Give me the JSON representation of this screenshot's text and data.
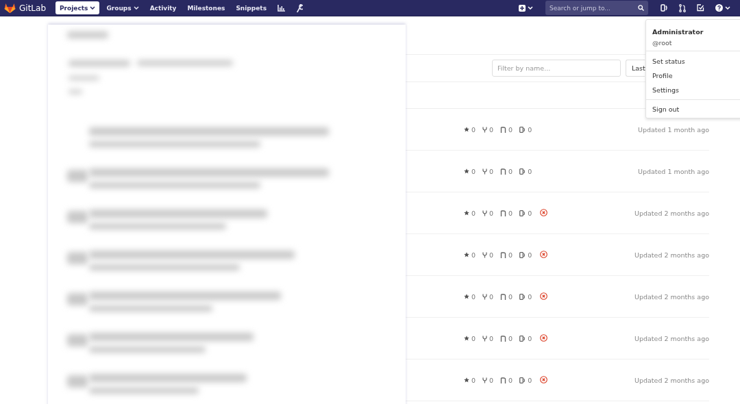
{
  "navbar": {
    "brand": "GitLab",
    "items": [
      {
        "kind": "text",
        "label": "Projects",
        "selected": true,
        "dropdown": true
      },
      {
        "kind": "text",
        "label": "Groups",
        "selected": false,
        "dropdown": true
      },
      {
        "kind": "text",
        "label": "Activity",
        "selected": false,
        "dropdown": false
      },
      {
        "kind": "text",
        "label": "Milestones",
        "selected": false,
        "dropdown": false
      },
      {
        "kind": "text",
        "label": "Snippets",
        "selected": false,
        "dropdown": false
      },
      {
        "kind": "chart",
        "selected": false,
        "dropdown": false
      },
      {
        "kind": "wrench",
        "selected": false,
        "dropdown": false
      }
    ],
    "search": {
      "placeholder": "Search or jump to..."
    }
  },
  "filter": {
    "placeholder": "Filter by name...",
    "sort_label": "Last"
  },
  "projects": [
    {
      "stars": "0",
      "forks": "0",
      "merge_requests": "0",
      "issues": "0",
      "pipeline_failed": false,
      "updated": "Updated 1 month ago"
    },
    {
      "stars": "0",
      "forks": "0",
      "merge_requests": "0",
      "issues": "0",
      "pipeline_failed": false,
      "updated": "Updated 1 month ago"
    },
    {
      "stars": "0",
      "forks": "0",
      "merge_requests": "0",
      "issues": "0",
      "pipeline_failed": true,
      "updated": "Updated 2 months ago"
    },
    {
      "stars": "0",
      "forks": "0",
      "merge_requests": "0",
      "issues": "0",
      "pipeline_failed": true,
      "updated": "Updated 2 months ago"
    },
    {
      "stars": "0",
      "forks": "0",
      "merge_requests": "0",
      "issues": "0",
      "pipeline_failed": true,
      "updated": "Updated 2 months ago"
    },
    {
      "stars": "0",
      "forks": "0",
      "merge_requests": "0",
      "issues": "0",
      "pipeline_failed": true,
      "updated": "Updated 2 months ago"
    },
    {
      "stars": "0",
      "forks": "0",
      "merge_requests": "0",
      "issues": "0",
      "pipeline_failed": true,
      "updated": "Updated 2 months ago"
    }
  ],
  "user_menu": {
    "name": "Administrator",
    "username": "@root",
    "items": [
      {
        "label": "Set status",
        "separated": false
      },
      {
        "label": "Profile",
        "separated": false
      },
      {
        "label": "Settings",
        "separated": false
      },
      {
        "label": "Sign out",
        "separated": true
      }
    ]
  }
}
